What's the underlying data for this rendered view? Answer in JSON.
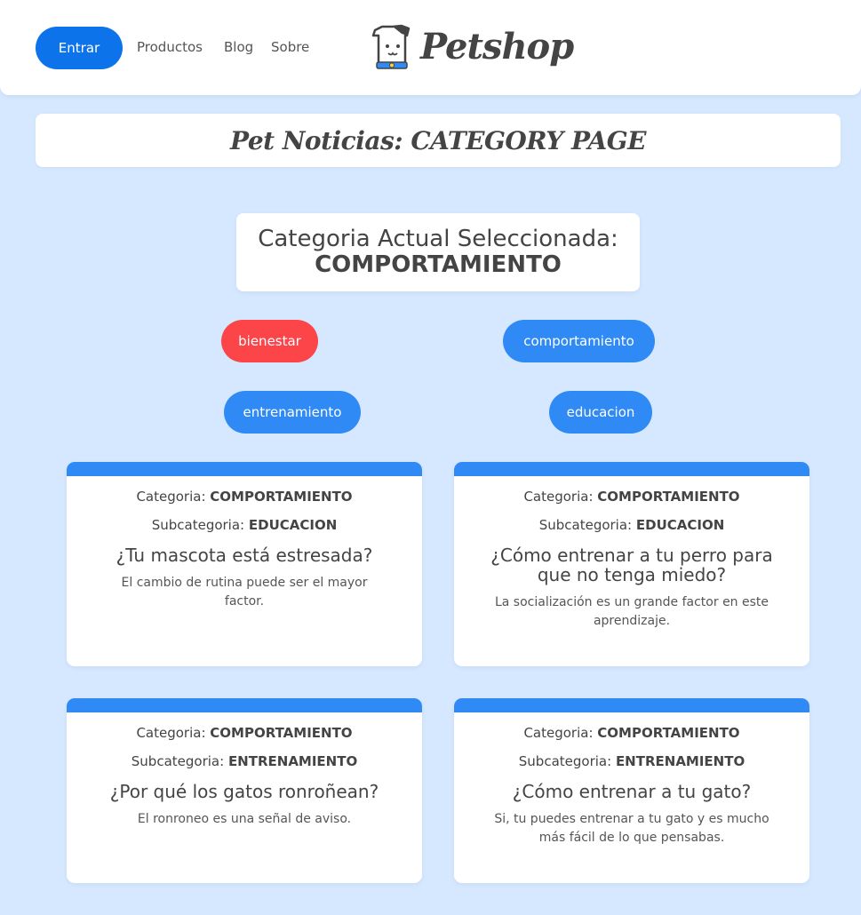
{
  "header": {
    "login_label": "Entrar",
    "nav": [
      "Productos",
      "Blog",
      "Sobre"
    ],
    "brand": "Petshop"
  },
  "page_title": "Pet Noticias: CATEGORY PAGE",
  "current_category": {
    "label": "Categoria Actual Seleccionada:",
    "value": "COMPORTAMIENTO"
  },
  "filters": [
    {
      "label": "bienestar",
      "color": "#fc4549"
    },
    {
      "label": "comportamiento",
      "color": "#2f8af5"
    },
    {
      "label": "entrenamiento",
      "color": "#2f8af5"
    },
    {
      "label": "educacion",
      "color": "#2f8af5"
    }
  ],
  "labels": {
    "category": "Categoria:",
    "subcategory": "Subcategoria:"
  },
  "posts": [
    {
      "category": "COMPORTAMIENTO",
      "subcategory": "EDUCACION",
      "title": "¿Tu mascota está estresada?",
      "description": "El cambio de rutina puede ser el mayor factor."
    },
    {
      "category": "COMPORTAMIENTO",
      "subcategory": "EDUCACION",
      "title": "¿Cómo entrenar a tu perro para que no tenga miedo?",
      "description": "La socialización es un grande factor en este aprendizaje."
    },
    {
      "category": "COMPORTAMIENTO",
      "subcategory": "ENTRENAMIENTO",
      "title": "¿Por qué los gatos ronroñean?",
      "description": "El ronroneo es una señal de aviso."
    },
    {
      "category": "COMPORTAMIENTO",
      "subcategory": "ENTRENAMIENTO",
      "title": "¿Cómo entrenar a tu gato?",
      "description": "Si, tu puedes entrenar a tu gato y es mucho más fácil de lo que pensabas."
    }
  ]
}
